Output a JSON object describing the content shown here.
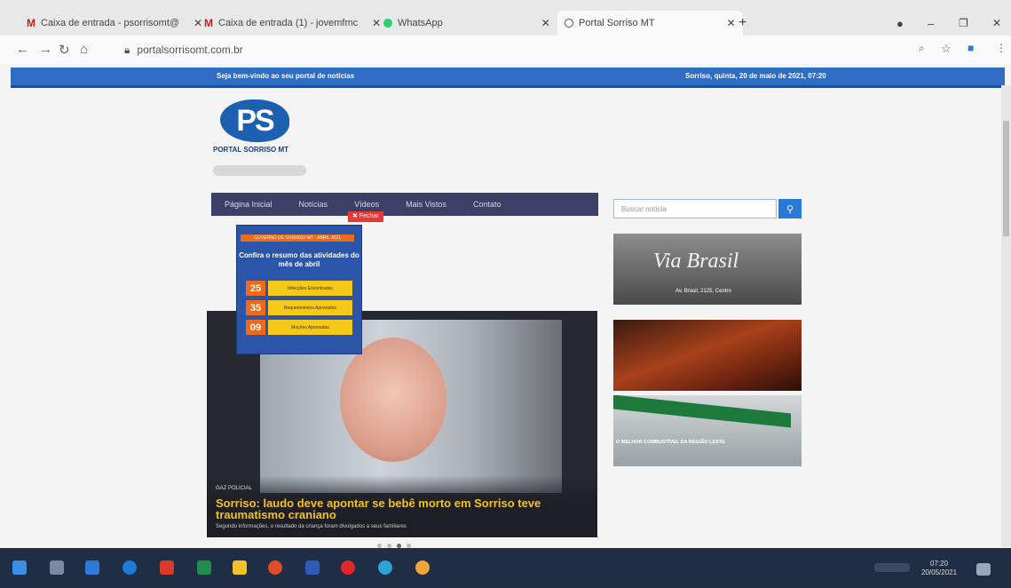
{
  "browser": {
    "tabs": [
      {
        "label": "Caixa de entrada - psorrisomt@",
        "icon": "gmail-icon"
      },
      {
        "label": "Caixa de entrada (1) - jovemfmc",
        "icon": "gmail-icon"
      },
      {
        "label": "WhatsApp",
        "icon": "whatsapp-icon"
      },
      {
        "label": "Portal Sorriso MT",
        "icon": "globe-icon"
      }
    ],
    "url": "portalsorrisomt.com.br"
  },
  "site": {
    "topbar_left": "Seja bem-vindo ao seu portal de notícias",
    "topbar_right": "Sorriso, quinta, 20 de maio de 2021, 07:20",
    "logo_text": "PS",
    "logo_name": "PORTAL SORRISO MT",
    "nav": [
      "Página Inicial",
      "Notícias",
      "Vídeos",
      "Mais Vistos",
      "Contato"
    ],
    "close_label": "✖ Fechar",
    "search_placeholder": "Buscar notícia"
  },
  "popup": {
    "bar": "GOVERNO DE SORRISO MT - ABRIL 2021",
    "headline": "Confira o resumo das atividades do mês de abril",
    "stats": [
      {
        "num": "25",
        "label": "Infecções Encontradas"
      },
      {
        "num": "35",
        "label": "Requerimentos Aprovados"
      },
      {
        "num": "09",
        "label": "Moções Aprovadas"
      }
    ]
  },
  "hero": {
    "category": "GAZ POLICIAL",
    "title": "Sorriso: laudo deve apontar se bebê morto em Sorriso teve traumatismo craniano",
    "subtitle": "Segundo informações, o resultado da criança foram divulgados a seus familiares"
  },
  "ads": {
    "ad1_brand": "Via Brasil",
    "ad1_addr": "Av. Brasil, 2125, Centro",
    "ad3_text": "O MELHOR COMBUSTÍVEL DA REGIÃO LESTE"
  },
  "taskbar": {
    "time": "07:20",
    "date": "20/05/2021"
  }
}
